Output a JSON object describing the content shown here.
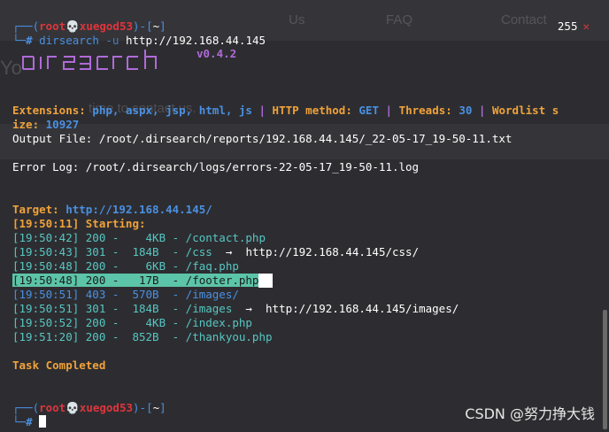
{
  "bg_site": {
    "nav_items": [
      "Us",
      "FAQ",
      "Contact"
    ],
    "heading": "Yo",
    "subtext": "time to contact us."
  },
  "prompt1": {
    "user": "root",
    "host": "xuegod53",
    "dir": "~",
    "command_name": "dirsearch",
    "command_flag": "-u",
    "command_arg": "http://192.168.44.145"
  },
  "exit_badge": {
    "code": "255",
    "icon": "x-icon"
  },
  "banner": {
    "version": "v0.4.2"
  },
  "config": {
    "extensions_label": "Extensions:",
    "extensions_value": "php, aspx, jsp, html, js",
    "method_label": "HTTP method:",
    "method_value": "GET",
    "threads_label": "Threads:",
    "threads_value": "30",
    "wordlist_label_part1": "Wordlist s",
    "wordlist_label_part2": "ize:",
    "wordlist_value": "10927"
  },
  "output_file": "Output File: /root/.dirsearch/reports/192.168.44.145/_22-05-17_19-50-11.txt",
  "error_log": "Error Log: /root/.dirsearch/logs/errors-22-05-17_19-50-11.log",
  "target": {
    "label": "Target:",
    "value": "http://192.168.44.145/"
  },
  "starting": "[19:50:11] Starting:",
  "results": [
    {
      "text": "[19:50:42] 200 -    4KB - /contact.php",
      "redirect": "",
      "color": "cyan",
      "highlight": false
    },
    {
      "text": "[19:50:43] 301 -  184B  - /css",
      "redirect": "http://192.168.44.145/css/",
      "color": "cyan",
      "highlight": false
    },
    {
      "text": "[19:50:48] 200 -    6KB - /faq.php",
      "redirect": "",
      "color": "cyan",
      "highlight": false
    },
    {
      "text": "[19:50:48] 200 -   17B  - /footer.php",
      "redirect": "",
      "color": "hl",
      "highlight": true
    },
    {
      "text": "[19:50:51] 403 -  570B  - /images/",
      "redirect": "",
      "color": "blue",
      "highlight": false
    },
    {
      "text": "[19:50:51] 301 -  184B  - /images",
      "redirect": "http://192.168.44.145/images/",
      "color": "cyan",
      "highlight": false
    },
    {
      "text": "[19:50:52] 200 -    4KB - /index.php",
      "redirect": "",
      "color": "cyan",
      "highlight": false
    },
    {
      "text": "[19:51:20] 200 -  852B  - /thankyou.php",
      "redirect": "",
      "color": "cyan",
      "highlight": false
    }
  ],
  "arrow": "→",
  "task_completed": "Task Completed",
  "prompt2": {
    "user": "root",
    "host": "xuegod53",
    "dir": "~"
  },
  "watermark": "CSDN @努力挣大钱",
  "colors": {
    "background": "#2d2d31",
    "red": "#e0343c",
    "blue": "#4a90e2",
    "cyan": "#57c6c2",
    "orange": "#f0a23a",
    "purple": "#b06ad8",
    "highlight": "#5cc4a8"
  }
}
